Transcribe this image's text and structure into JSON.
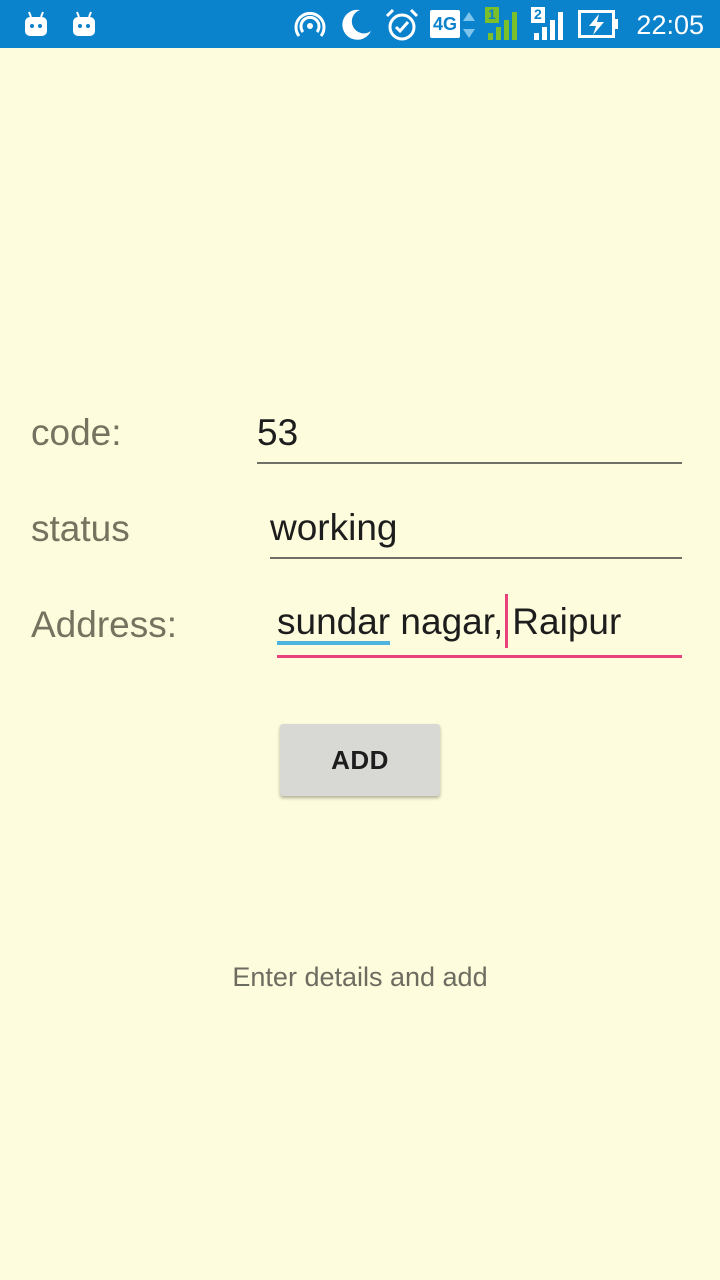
{
  "status_bar": {
    "time": "22:05",
    "icons": [
      "android-notification-icon",
      "android-notification-icon",
      "hotspot-icon",
      "night-mode-icon",
      "alarm-icon",
      "network-4g-icon",
      "signal-sim1-icon",
      "signal-sim2-icon",
      "battery-charging-icon"
    ],
    "sim1_label": "1",
    "sim2_label": "2",
    "network_label": "4G",
    "color": "#0b82cc"
  },
  "form": {
    "code": {
      "label": "code:",
      "value": "53"
    },
    "status": {
      "label": "status",
      "value": "working"
    },
    "address": {
      "label": "Address:",
      "value_part1": "sundar",
      "value_part2": " nagar,",
      "value_part3": "Raipur"
    },
    "add_button": "ADD"
  },
  "hint_text": "Enter details and add",
  "colors": {
    "background": "#fdfcdc",
    "accent": "#e8417c",
    "spellcheck": "#4fb3e0"
  }
}
